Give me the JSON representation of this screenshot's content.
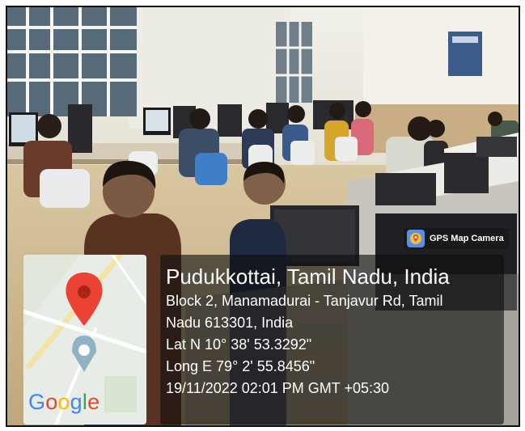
{
  "app": {
    "badge_label": "GPS Map Camera",
    "badge_icon": "map-pin-icon"
  },
  "location": {
    "title": "Pudukkottai, Tamil Nadu, India",
    "address_line1": "Block 2, Manamadurai - Tanjavur Rd, Tamil",
    "address_line2": "Nadu 613301, India",
    "latitude": "Lat N 10° 38' 53.3292\"",
    "longitude": "Long E 79° 2' 55.8456\"",
    "timestamp": "19/11/2022 02:01 PM GMT +05:30"
  },
  "map": {
    "logo_text": "Google",
    "pin_icon": "location-pin-icon",
    "pin_color": "#ea4335"
  },
  "colors": {
    "overlay": "#0f0f0f",
    "badge_icon_bg": "#5a8fe8",
    "text": "#ffffff"
  }
}
